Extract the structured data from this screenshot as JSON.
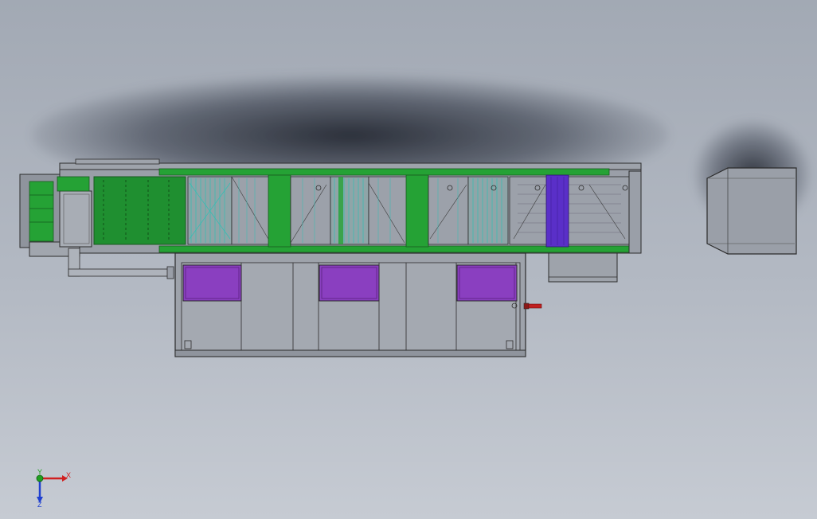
{
  "viewport": {
    "triad": {
      "x_label": "X",
      "y_label": "Y",
      "z_label": "Z",
      "x_color": "#d02020",
      "y_color": "#20a020",
      "z_color": "#2040d0"
    }
  },
  "model": {
    "colors": {
      "frame": "#9a9fa8",
      "frame_dark": "#7f848d",
      "edge": "#2b2b2b",
      "green_panel": "#25a235",
      "green_belt": "#1f8f30",
      "cyan_mesh": "#2fc0b5",
      "purple_door": "#8a3fc0",
      "violet_section": "#5a2fc8",
      "valve_red": "#c02020"
    },
    "doors": [
      "door-1",
      "door-2",
      "door-3"
    ]
  }
}
